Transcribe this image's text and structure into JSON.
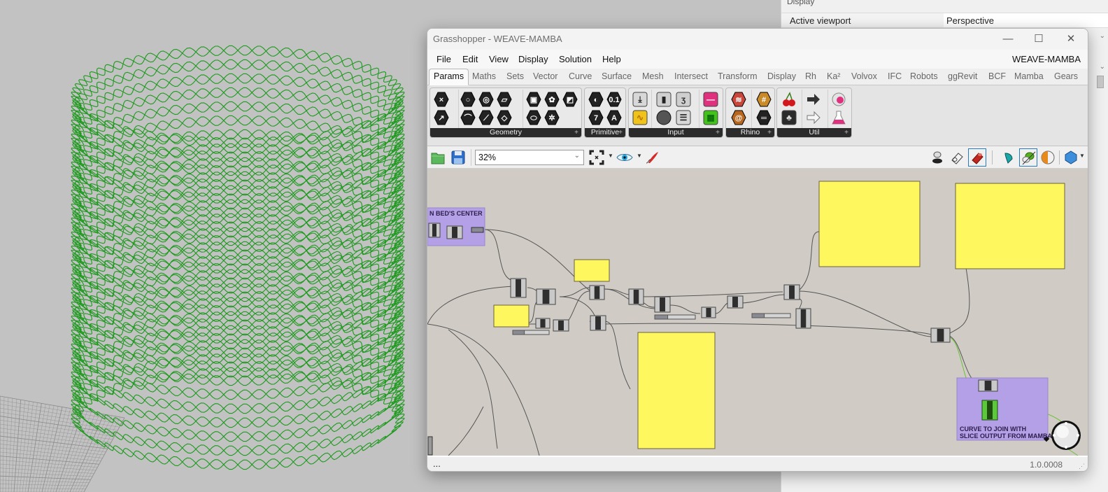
{
  "rhino_properties": {
    "section_title": "Display",
    "rows": [
      {
        "label": "Active viewport",
        "value": "Perspective"
      }
    ]
  },
  "grasshopper": {
    "window_title": "Grasshopper - WEAVE-MAMBA",
    "document_name": "WEAVE-MAMBA",
    "window_controls": {
      "minimize": "—",
      "maximize": "☐",
      "close": "✕"
    },
    "menu": [
      "File",
      "Edit",
      "View",
      "Display",
      "Solution",
      "Help"
    ],
    "tabs": [
      {
        "label": "Params",
        "active": true
      },
      {
        "label": "Maths"
      },
      {
        "label": "Sets"
      },
      {
        "label": "Vector"
      },
      {
        "label": "Curve"
      },
      {
        "label": "Surface"
      },
      {
        "label": "Mesh"
      },
      {
        "label": "Intersect"
      },
      {
        "label": "Transform"
      },
      {
        "label": "Display"
      },
      {
        "label": "Rh"
      },
      {
        "label": "Ka²"
      },
      {
        "label": "Volvox"
      },
      {
        "label": "IFC"
      },
      {
        "label": "Robots"
      },
      {
        "label": "ggRevit"
      },
      {
        "label": "BCF"
      },
      {
        "label": "Mamba"
      },
      {
        "label": "Gears"
      }
    ],
    "ribbon_panels": [
      {
        "label": "Geometry",
        "icons": [
          "point-param-icon",
          "vector-param-icon",
          "circle-param-icon",
          "arc-param-icon",
          "curve-param-icon",
          "line-param-icon",
          "plane-param-icon",
          "rectangle-param-icon",
          "box-param-icon",
          "brep-param-icon",
          "twisted-box-param-icon",
          "surface-param-icon",
          "mesh-param-icon",
          "field-param-icon"
        ]
      },
      {
        "label": "Primitive",
        "icons": [
          "boolean-param-icon",
          "number-param-icon",
          "integer-param-icon",
          "text-param-icon"
        ]
      },
      {
        "label": "Input",
        "icons": [
          "import-icon",
          "graph-mapper-icon",
          "toggle-icon",
          "button-icon",
          "panel-value-icon",
          "value-list-icon",
          "gradient-icon",
          "colour-swatch-icon"
        ]
      },
      {
        "label": "Rhino",
        "icons": [
          "layer-icon",
          "pattern-icon",
          "spiral-icon",
          "linetype-icon"
        ]
      },
      {
        "label": "Util",
        "icons": [
          "cherry-icon",
          "tree-icon",
          "arrow-right-icon",
          "arrow-outline-icon",
          "data-dam-icon",
          "flask-icon"
        ]
      }
    ],
    "toolbar": {
      "zoom_value": "32%",
      "left_icons": [
        "open-file-icon",
        "save-file-icon"
      ],
      "mid_icons": [
        "zoom-extents-icon",
        "preview-eye-icon",
        "sketch-pen-icon"
      ],
      "right_icons": [
        "preview-wireframe-icon",
        "preview-shaded-off-icon",
        "preview-shaded-on-icon",
        "preview-selected-icon",
        "preview-meshing-icon",
        "document-preview-icon",
        "mesh-quality-icon"
      ]
    },
    "canvas": {
      "groups": [
        {
          "label": "...N BED'S CENTER",
          "color": "#b3a0e6"
        },
        {
          "label": "CURVE TO JOIN WITH\nSLICE OUTPUT FROM MAMBA",
          "color": "#b3a0e6"
        }
      ],
      "group_label_lines": [
        "N BED'S CENTER",
        "CURVE TO JOIN WITH",
        "SLICE OUTPUT FROM MAMBA"
      ],
      "note_color": "#fff75e"
    },
    "status": {
      "left": "...",
      "version": "1.0.0008"
    }
  },
  "viewport": {
    "geometry_color": "#1e9a1e",
    "background": "#c2c2c2"
  }
}
